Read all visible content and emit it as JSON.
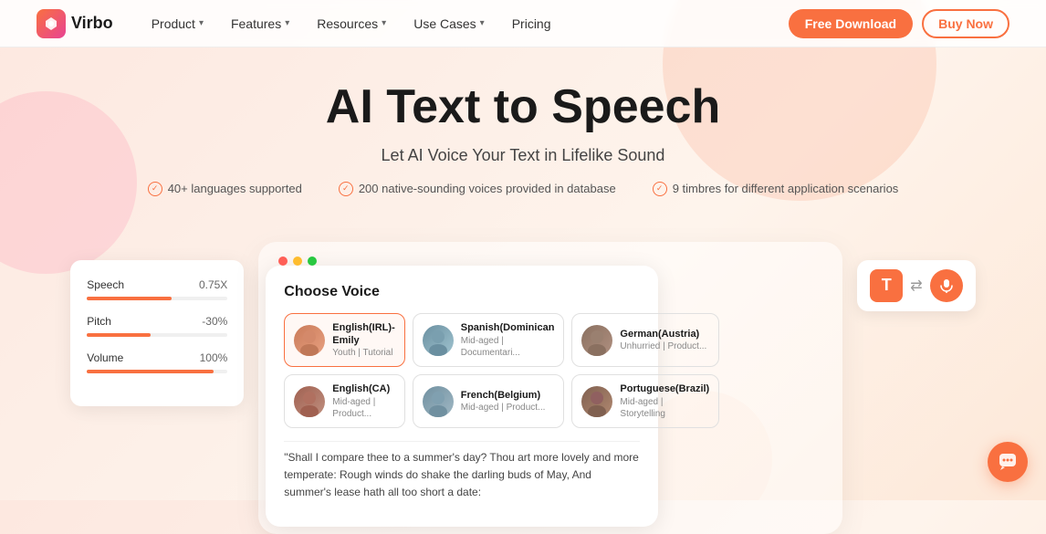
{
  "nav": {
    "logo_text": "Virbo",
    "items": [
      {
        "label": "Product",
        "has_dropdown": true
      },
      {
        "label": "Features",
        "has_dropdown": true
      },
      {
        "label": "Resources",
        "has_dropdown": true
      },
      {
        "label": "Use Cases",
        "has_dropdown": true
      },
      {
        "label": "Pricing",
        "has_dropdown": false
      }
    ],
    "btn_free_download": "Free Download",
    "btn_buy_now": "Buy Now"
  },
  "hero": {
    "title": "AI Text to Speech",
    "subtitle": "Let AI Voice Your Text in Lifelike Sound",
    "features": [
      {
        "text": "40+ languages supported"
      },
      {
        "text": "200 native-sounding voices provided in database"
      },
      {
        "text": "9 timbres for different application scenarios"
      }
    ]
  },
  "speech_controls": {
    "speech_label": "Speech",
    "speech_value": "0.75X",
    "pitch_label": "Pitch",
    "pitch_value": "-30%",
    "volume_label": "Volume",
    "volume_value": "100%"
  },
  "voice_chooser": {
    "title": "Choose Voice",
    "voices": [
      {
        "id": "emily",
        "name": "English(IRL)-Emily",
        "desc": "Youth | Tutorial",
        "selected": true
      },
      {
        "id": "spanish",
        "name": "Spanish(Dominican",
        "desc": "Mid-aged | Documentari...",
        "selected": false
      },
      {
        "id": "german",
        "name": "German(Austria)",
        "desc": "Unhurried | Product...",
        "selected": false
      },
      {
        "id": "english-ca",
        "name": "English(CA)",
        "desc": "Mid-aged | Product...",
        "selected": false
      },
      {
        "id": "french",
        "name": "French(Belgium)",
        "desc": "Mid-aged | Product...",
        "selected": false
      },
      {
        "id": "portuguese",
        "name": "Portuguese(Brazil)",
        "desc": "Mid-aged | Storytelling",
        "selected": false
      }
    ],
    "sample_text": "\"Shall I compare thee to a summer's day?\nThou art more lovely and more temperate:\nRough winds do shake the darling buds of May,\nAnd summer's lease hath all too short a date:"
  },
  "tts_widget": {
    "t_label": "T",
    "arrows": "⇄",
    "mic_icon": "🎤"
  },
  "chat_widget": {
    "icon": "💬"
  },
  "window_chrome": {
    "dots": [
      "red",
      "yellow",
      "green"
    ]
  }
}
